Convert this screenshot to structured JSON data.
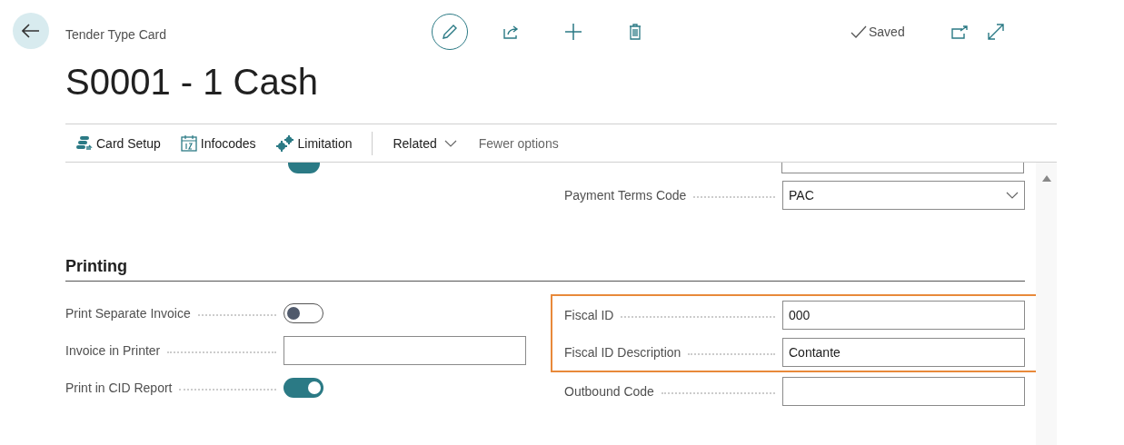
{
  "header": {
    "caption": "Tender Type Card",
    "title": "S0001 - 1 Cash",
    "status": "Saved"
  },
  "actions": [
    {
      "label": "Card Setup",
      "kind": "setup"
    },
    {
      "label": "Infocodes",
      "kind": "calendar"
    },
    {
      "label": "Limitation",
      "kind": "gears"
    }
  ],
  "menu": [
    {
      "label": "Related",
      "kind": "dropdown"
    },
    {
      "label": "Fewer options",
      "kind": "plain"
    }
  ],
  "top_section": {
    "left_toggle_on": true,
    "right": [
      {
        "label": "Payment Terms Code",
        "kind": "select",
        "value": "PAC"
      }
    ]
  },
  "printing": {
    "title": "Printing",
    "left": [
      {
        "label": "Print Separate Invoice",
        "kind": "toggle",
        "on": false
      },
      {
        "label": "Invoice in Printer",
        "kind": "text"
      },
      {
        "label": "Print in CID Report",
        "kind": "toggle",
        "on": true
      }
    ],
    "right": [
      {
        "kind": "group",
        "highlighted": true,
        "fields": [
          {
            "label": "Fiscal ID",
            "kind": "text",
            "value": "000"
          },
          {
            "label": "Fiscal ID Description",
            "kind": "text",
            "value": "Contante"
          }
        ]
      },
      {
        "label": "Outbound Code",
        "kind": "text"
      }
    ]
  }
}
